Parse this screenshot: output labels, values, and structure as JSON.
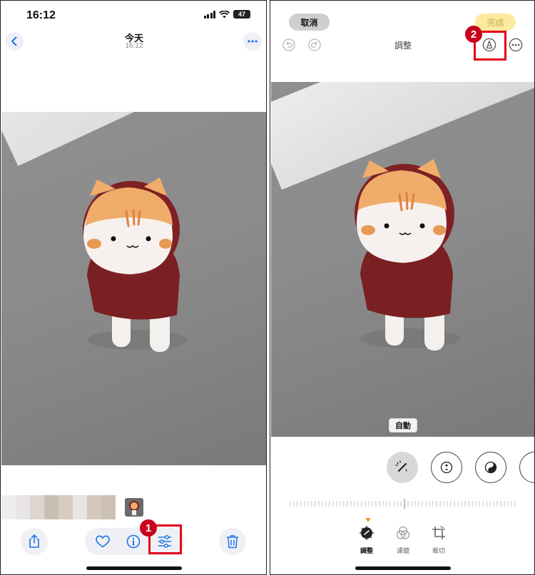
{
  "left": {
    "status_bar": {
      "time": "16:12",
      "battery": "47"
    },
    "header": {
      "title": "今天",
      "subtitle": "16:12"
    },
    "annotation": {
      "step": "1"
    }
  },
  "right": {
    "cancel_label": "取消",
    "done_label": "完成",
    "mode_title": "調整",
    "auto_label": "自動",
    "tabs": [
      {
        "label": "調整",
        "icon": "adjust-dial-icon",
        "active": true
      },
      {
        "label": "濾鏡",
        "icon": "filter-circles-icon",
        "active": false
      },
      {
        "label": "裁切",
        "icon": "crop-rotate-icon",
        "active": false
      }
    ],
    "annotation": {
      "step": "2"
    }
  },
  "colors": {
    "accent": "#1f74e8",
    "highlight": "#e0001a",
    "done_bg": "#fbeaa0",
    "slider_marker": "#f0a020"
  }
}
